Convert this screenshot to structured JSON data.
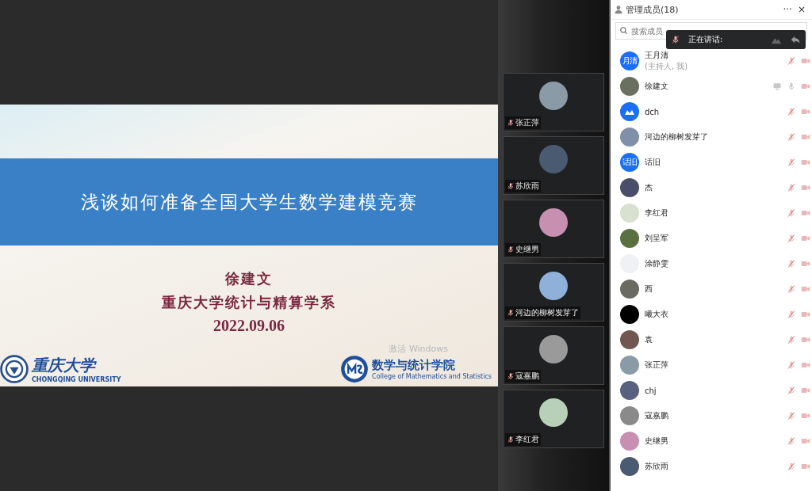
{
  "slide": {
    "title": "浅谈如何准备全国大学生数学建模竞赛",
    "lines": [
      "徐建文",
      "重庆大学统计与精算学系",
      "2022.09.06"
    ],
    "left_logo": {
      "name": "重庆大学",
      "subtitle": "CHONGQING UNIVERSITY"
    },
    "right_logo": {
      "name": "数学与统计学院",
      "subtitle": "College of Mathematics and Statistics"
    },
    "system_notice": "激活 Windows"
  },
  "video_tiles": [
    {
      "name": "张正萍",
      "muted": true,
      "color": "#8a9aa6"
    },
    {
      "name": "苏欣雨",
      "muted": true,
      "color": "#4a5a70"
    },
    {
      "name": "史继男",
      "muted": true,
      "color": "#c890b0"
    },
    {
      "name": "河边的柳树发芽了",
      "muted": true,
      "color": "#8fb0d8"
    },
    {
      "name": "寇嘉鹏",
      "muted": true,
      "color": "#9a9a9a"
    },
    {
      "name": "李红君",
      "muted": true,
      "color": "#b8d0b8"
    }
  ],
  "panel": {
    "title": "管理成员(18)",
    "more": "···",
    "close": "×",
    "search": {
      "placeholder": "搜索成员"
    },
    "speaking": {
      "label": "正在讲话:"
    }
  },
  "members": [
    {
      "name": "王月清",
      "note": "(主持人, 我)",
      "kind": "text",
      "avatar_text": "月清",
      "muted": true,
      "sharing": false
    },
    {
      "name": "徐建文",
      "kind": "photo",
      "color": "#6a7060",
      "muted": false,
      "sharing": true
    },
    {
      "name": "dch",
      "kind": "logo",
      "muted": true,
      "sharing": false
    },
    {
      "name": "河边的柳树发芽了",
      "kind": "photo",
      "color": "#8090a8",
      "muted": true,
      "sharing": false
    },
    {
      "name": "话旧",
      "kind": "text",
      "avatar_text": "话旧",
      "muted": true,
      "sharing": false
    },
    {
      "name": "杰",
      "kind": "photo",
      "color": "#4a4e68",
      "muted": true,
      "sharing": false
    },
    {
      "name": "李红君",
      "kind": "photo",
      "color": "#d8e0d0",
      "muted": true,
      "sharing": false
    },
    {
      "name": "刘呈军",
      "kind": "photo",
      "color": "#5a7040",
      "muted": true,
      "sharing": false
    },
    {
      "name": "涂静雯",
      "kind": "photo",
      "color": "#eef2f4",
      "muted": true,
      "sharing": false
    },
    {
      "name": "西",
      "kind": "photo",
      "color": "#6a6a60",
      "muted": true,
      "sharing": false
    },
    {
      "name": "曦大衣",
      "kind": "photo",
      "color": "#000000",
      "muted": true,
      "sharing": false
    },
    {
      "name": "袁",
      "kind": "photo",
      "color": "#705850",
      "muted": true,
      "sharing": false
    },
    {
      "name": "张正萍",
      "kind": "photo",
      "color": "#8a9aa6",
      "muted": true,
      "sharing": false
    },
    {
      "name": "chj",
      "kind": "photo",
      "color": "#5a6080",
      "muted": true,
      "sharing": false
    },
    {
      "name": "寇嘉鹏",
      "kind": "photo",
      "color": "#8a8a8a",
      "muted": true,
      "sharing": false
    },
    {
      "name": "史继男",
      "kind": "photo",
      "color": "#c890b0",
      "muted": true,
      "sharing": false
    },
    {
      "name": "苏欣雨",
      "kind": "photo",
      "color": "#4a5a70",
      "muted": true,
      "sharing": false
    }
  ]
}
